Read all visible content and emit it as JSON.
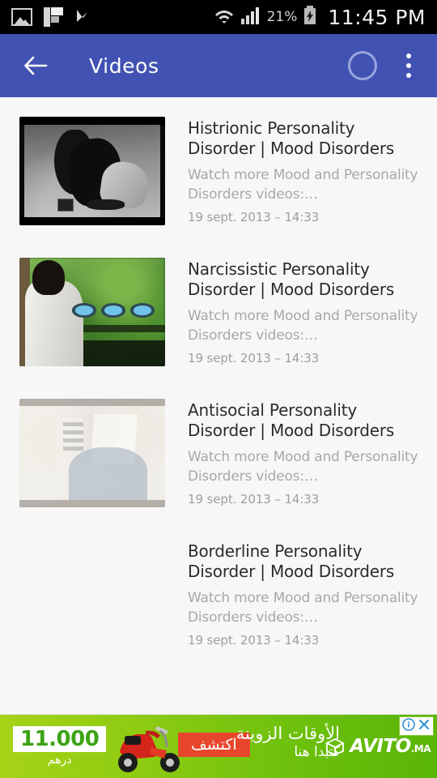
{
  "statusbar": {
    "icons_left": [
      "gallery-image-icon",
      "flipboard-icon",
      "checkmark-flag-icon"
    ],
    "icons_right": [
      "wifi-icon",
      "signal-bars-icon",
      "battery-charging-icon"
    ],
    "battery_percent": "21%",
    "clock": "11:45 PM"
  },
  "appbar": {
    "back_icon": "back-arrow-icon",
    "title": "Videos",
    "progress_icon": "loading-ring-icon",
    "overflow_icon": "overflow-menu-icon",
    "background_color": "#4152b3"
  },
  "videos": [
    {
      "title": "Histrionic Personality Disorder | Mood Disorders",
      "description": "Watch more Mood and Personality Disorders videos:…",
      "date": "19 sept. 2013 – 14:33",
      "thumbnail": "bw-woman-sitting-on-sand",
      "has_thumbnail": true
    },
    {
      "title": "Narcissistic Personality Disorder | Mood Disorders",
      "description": "Watch more Mood and Personality Disorders videos:…",
      "date": "19 sept. 2013 – 14:33",
      "thumbnail": "woman-from-behind-green-foliage",
      "has_thumbnail": true
    },
    {
      "title": "Antisocial Personality Disorder | Mood Disorders",
      "description": "Watch more Mood and Personality Disorders videos:…",
      "date": "19 sept. 2013 – 14:33",
      "thumbnail": "faded-crowded-room",
      "has_thumbnail": true
    },
    {
      "title": "Borderline Personality Disorder | Mood Disorders",
      "description": "Watch more Mood and Personality Disorders videos:…",
      "date": "19 sept. 2013 – 14:33",
      "thumbnail": "",
      "has_thumbnail": false
    }
  ],
  "ad": {
    "price": "11.000",
    "currency": "درهم",
    "cta": "اكتشف",
    "headline_line1": "الأوقات الزوينة",
    "headline_line2": "كتبدا هنا",
    "brand": "AVITO",
    "brand_tld": ".MA",
    "product_icon": "red-scooter-image",
    "info_icon": "ad-info-icon",
    "close_icon": "ad-close-icon",
    "background_color": "#8fcc12"
  }
}
